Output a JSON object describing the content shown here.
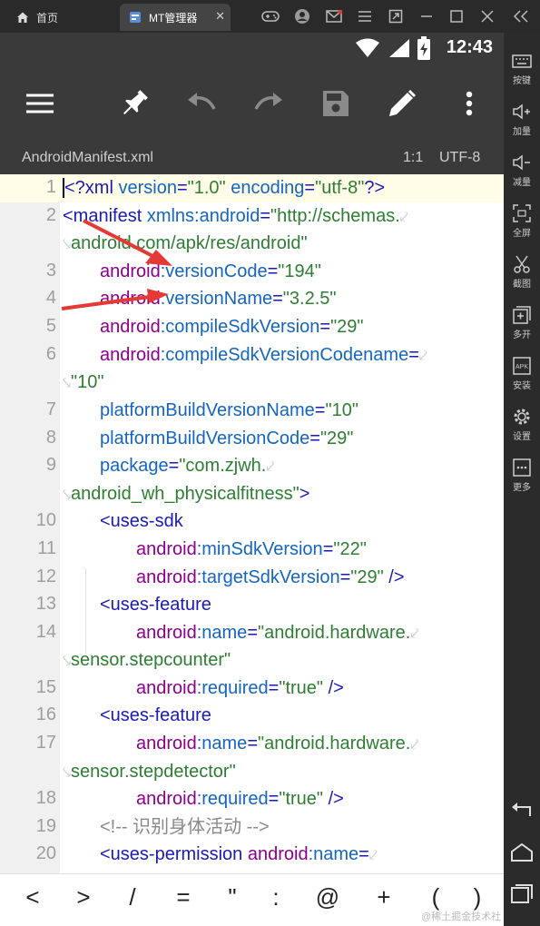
{
  "window": {
    "tabs": [
      {
        "label": "首页"
      },
      {
        "label": "MT管理器"
      }
    ],
    "close_glyph": "✕"
  },
  "status": {
    "time": "12:43"
  },
  "file": {
    "name": "AndroidManifest.xml",
    "position": "1:1",
    "encoding": "UTF-8"
  },
  "editor": {
    "line_numbers": [
      "1",
      "2",
      "3",
      "4",
      "5",
      "6",
      "7",
      "8",
      "9",
      "10",
      "11",
      "12",
      "13",
      "14",
      "15",
      "16",
      "17",
      "18",
      "19",
      "20"
    ],
    "t": {
      "l1a": "<?xml ",
      "l1b": "version",
      "l1c": "=",
      "l1d": "\"1.0\"",
      "l1e": " encoding",
      "l1f": "=",
      "l1g": "\"utf-8\"",
      "l1h": "?>",
      "l2a": "<manifest ",
      "l2b": "xmlns:android",
      "l2c": "=",
      "l2d": "\"http://schemas.",
      "l2w": "android.com/apk/res/android\"",
      "l3a": "android",
      "l3b": ":versionCode",
      "l3c": "=",
      "l3d": "\"194\"",
      "l4a": "android",
      "l4b": ":versionName",
      "l4c": "=",
      "l4d": "\"3.2.5\"",
      "l5a": "android",
      "l5b": ":compileSdkVersion",
      "l5c": "=",
      "l5d": "\"29\"",
      "l6a": "android",
      "l6b": ":compileSdkVersionCodename",
      "l6c": "=",
      "l6w": "\"10\"",
      "l7a": "platformBuildVersionName",
      "l7b": "=",
      "l7c": "\"10\"",
      "l8a": "platformBuildVersionCode",
      "l8b": "=",
      "l8c": "\"29\"",
      "l9a": "package",
      "l9b": "=",
      "l9c": "\"com.zjwh.",
      "l9w": "android_wh_physicalfitness\"",
      "l9x": ">",
      "l10a": "<uses-sdk",
      "l11a": "android",
      "l11b": ":minSdkVersion",
      "l11c": "=",
      "l11d": "\"22\"",
      "l12a": "android",
      "l12b": ":targetSdkVersion",
      "l12c": "=",
      "l12d": "\"29\"",
      "l12e": " />",
      "l13a": "<uses-feature",
      "l14a": "android",
      "l14b": ":name",
      "l14c": "=",
      "l14d": "\"android.hardware.",
      "l14w": "sensor.stepcounter\"",
      "l15a": "android",
      "l15b": ":required",
      "l15c": "=",
      "l15d": "\"true\"",
      "l15e": " />",
      "l16a": "<uses-feature",
      "l17a": "android",
      "l17b": ":name",
      "l17c": "=",
      "l17d": "\"android.hardware.",
      "l17w": "sensor.stepdetector\"",
      "l18a": "android",
      "l18b": ":required",
      "l18c": "=",
      "l18d": "\"true\"",
      "l18e": " />",
      "l19a": "<!-- 识别身体活动 -->",
      "l20a": "<uses-permission ",
      "l20b": "android",
      "l20c": ":name",
      "l20d": "="
    }
  },
  "symbols": [
    "<",
    ">",
    "/",
    "=",
    "\"",
    ":",
    "@",
    "+",
    "(",
    ")"
  ],
  "watermark": "@稀土掘金技术社区",
  "sidebar": {
    "items": [
      {
        "label": "按键"
      },
      {
        "label": "加量"
      },
      {
        "label": "减量"
      },
      {
        "label": "全屏"
      },
      {
        "label": "截图"
      },
      {
        "label": "多开"
      },
      {
        "label": "安装"
      },
      {
        "label": "设置"
      },
      {
        "label": "更多"
      }
    ],
    "apk_glyph": "APK"
  },
  "colors": {
    "tag": "#1a1ab8",
    "attribute": "#1565c0",
    "namespace": "#8b008b",
    "string": "#2e7d32",
    "annotation_arrow": "#e53935"
  }
}
